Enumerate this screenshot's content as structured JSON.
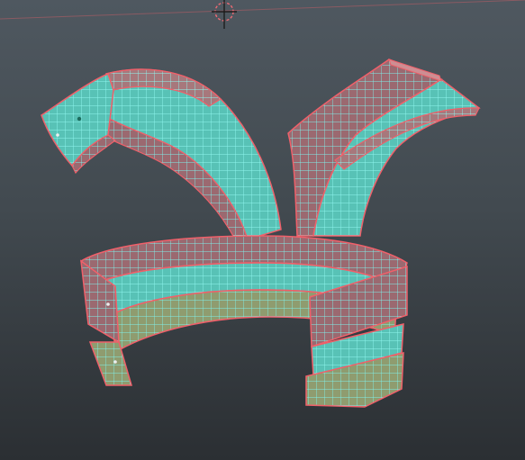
{
  "viewport": {
    "kind": "3d-modeling-viewport",
    "background_top": "#4f5860",
    "background_bottom": "#2b2f33",
    "wire_color": "#7ff0ea",
    "outline_color": "#f0606a",
    "pivot_color": "#f06a74"
  },
  "pivot": {
    "icon": "crosshair-pivot-icon"
  },
  "parts": [
    {
      "id": "strap-left",
      "icon": "mesh-strap"
    },
    {
      "id": "strap-right",
      "icon": "mesh-strap"
    },
    {
      "id": "belt",
      "icon": "mesh-belt"
    }
  ]
}
